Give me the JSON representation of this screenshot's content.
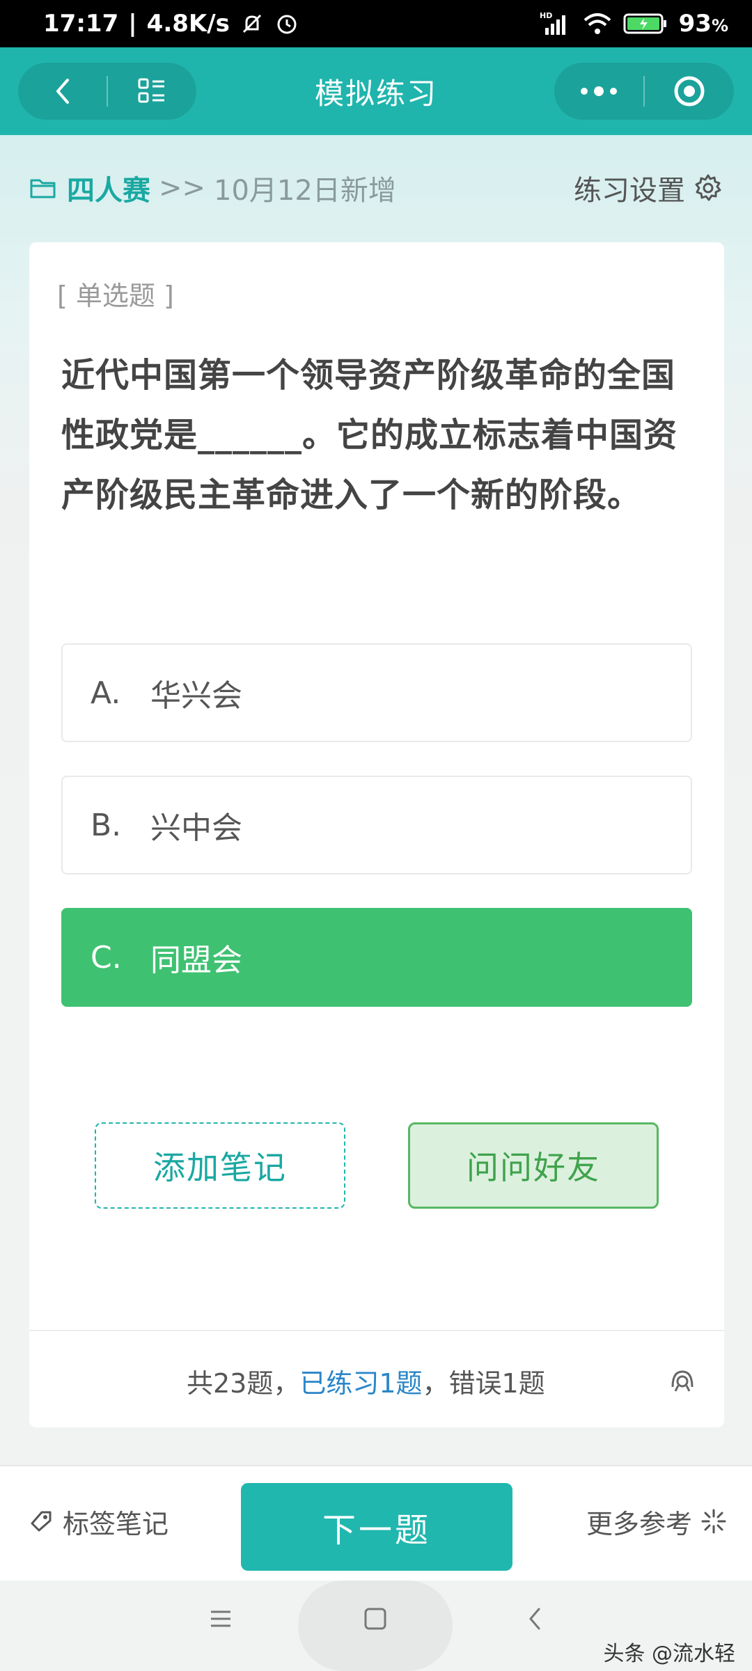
{
  "status_bar": {
    "time": "17:17",
    "speed": "4.8K/s",
    "network": "HD",
    "battery": "93",
    "battery_unit": "%"
  },
  "header": {
    "title": "模拟练习"
  },
  "breadcrumb": {
    "root": "四人赛",
    "separator": ">>",
    "leaf": "10月12日新增"
  },
  "settings_label": "练习设置",
  "question": {
    "type_label": "[ 单选题 ]",
    "text": "近代中国第一个领导资产阶级革命的全国性政党是______。它的成立标志着中国资产阶级民主革命进入了一个新的阶段。",
    "options": [
      {
        "letter": "A.",
        "text": "华兴会"
      },
      {
        "letter": "B.",
        "text": "兴中会"
      },
      {
        "letter": "C.",
        "text": "同盟会"
      }
    ],
    "selected_index": 2
  },
  "actions": {
    "add_note": "添加笔记",
    "ask_friend": "问问好友"
  },
  "progress": {
    "total_prefix": "共23题，",
    "practiced": "已练习1题",
    "wrong": "，错误1题"
  },
  "bottom_bar": {
    "tag_note": "标签笔记",
    "next": "下一题",
    "more_ref": "更多参考"
  },
  "watermark": "头条 @流水轻",
  "colors": {
    "brand": "#1fb5ad",
    "selected": "#3fc172",
    "link": "#2a86c8"
  }
}
